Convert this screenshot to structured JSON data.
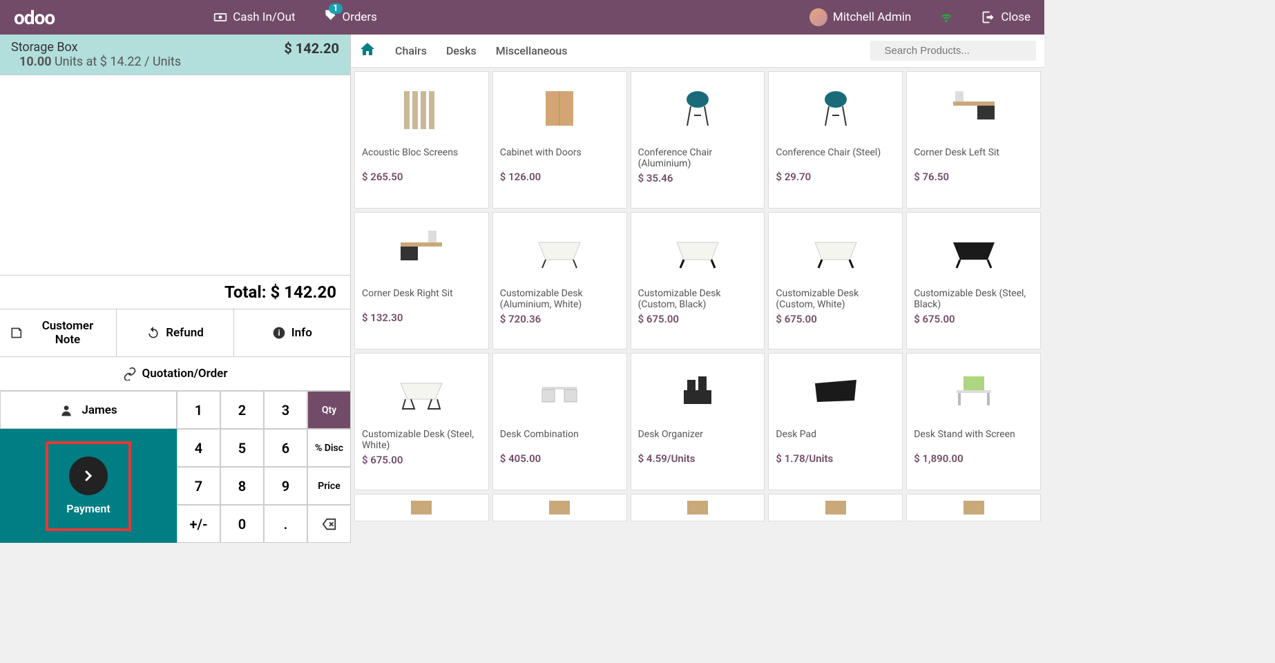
{
  "header": {
    "logo": "odoo",
    "cash_btn": "Cash In/Out",
    "orders_btn": "Orders",
    "orders_badge": "1",
    "user": "Mitchell Admin",
    "close": "Close"
  },
  "order": {
    "line": {
      "name": "Storage Box",
      "qty": "10.00",
      "unit_label": "Units at",
      "unit_price": "$ 14.22",
      "per": "/ Units",
      "total": "$ 142.20"
    },
    "total_label": "Total:",
    "total_value": "$ 142.20"
  },
  "actions": {
    "note": "Customer Note",
    "refund": "Refund",
    "info": "Info",
    "quotation": "Quotation/Order"
  },
  "pad": {
    "customer": "James",
    "payment": "Payment",
    "qty": "Qty",
    "disc": "% Disc",
    "price": "Price",
    "k1": "1",
    "k2": "2",
    "k3": "3",
    "k4": "4",
    "k5": "5",
    "k6": "6",
    "k7": "7",
    "k8": "8",
    "k9": "9",
    "kpm": "+/-",
    "k0": "0",
    "kdot": "."
  },
  "categories": {
    "chairs": "Chairs",
    "desks": "Desks",
    "misc": "Miscellaneous"
  },
  "search": {
    "placeholder": "Search Products..."
  },
  "products": [
    {
      "name": "Acoustic Bloc Screens",
      "price": "$ 265.50"
    },
    {
      "name": "Cabinet with Doors",
      "price": "$ 126.00"
    },
    {
      "name": "Conference Chair (Aluminium)",
      "price": "$ 35.46"
    },
    {
      "name": "Conference Chair (Steel)",
      "price": "$ 29.70"
    },
    {
      "name": "Corner Desk Left Sit",
      "price": "$ 76.50"
    },
    {
      "name": "Corner Desk Right Sit",
      "price": "$ 132.30"
    },
    {
      "name": "Customizable Desk (Aluminium, White)",
      "price": "$ 720.36"
    },
    {
      "name": "Customizable Desk (Custom, Black)",
      "price": "$ 675.00"
    },
    {
      "name": "Customizable Desk (Custom, White)",
      "price": "$ 675.00"
    },
    {
      "name": "Customizable Desk (Steel, Black)",
      "price": "$ 675.00"
    },
    {
      "name": "Customizable Desk (Steel, White)",
      "price": "$ 675.00"
    },
    {
      "name": "Desk Combination",
      "price": "$ 405.00"
    },
    {
      "name": "Desk Organizer",
      "price": "$ 4.59/Units"
    },
    {
      "name": "Desk Pad",
      "price": "$ 1.78/Units"
    },
    {
      "name": "Desk Stand with Screen",
      "price": "$ 1,890.00"
    }
  ]
}
